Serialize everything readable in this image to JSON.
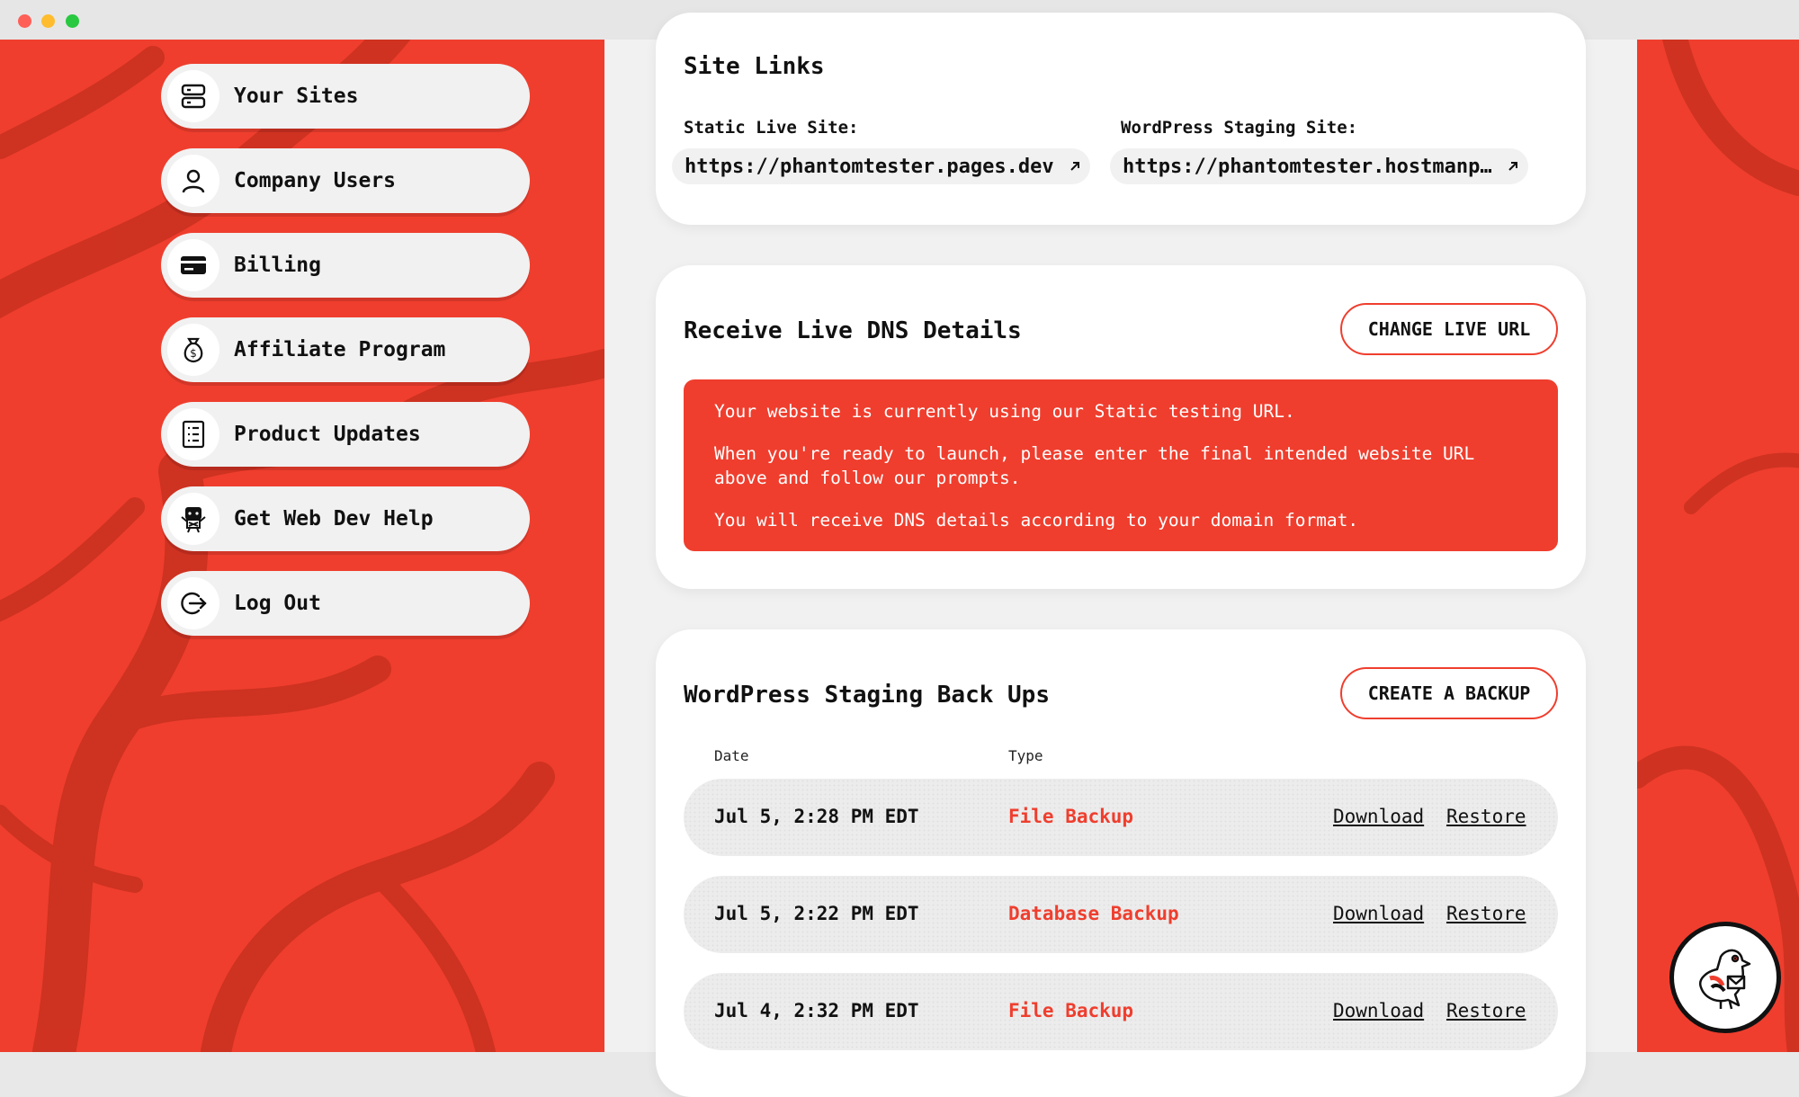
{
  "window": {
    "controls": [
      "close",
      "minimize",
      "maximize"
    ]
  },
  "sidebar": {
    "items": [
      {
        "label": "Your Sites",
        "icon": "server-icon"
      },
      {
        "label": "Company Users",
        "icon": "user-icon"
      },
      {
        "label": "Billing",
        "icon": "credit-card-icon"
      },
      {
        "label": "Affiliate Program",
        "icon": "money-bag-icon"
      },
      {
        "label": "Product Updates",
        "icon": "document-list-icon"
      },
      {
        "label": "Get Web Dev Help",
        "icon": "robot-icon"
      },
      {
        "label": "Log Out",
        "icon": "logout-icon"
      }
    ]
  },
  "site_links": {
    "title": "Site Links",
    "static_label": "Static Live Site:",
    "static_url": "https://phantomtester.pages.dev",
    "staging_label": "WordPress Staging Site:",
    "staging_url": "https://phantomtester.hostmanp…"
  },
  "dns": {
    "title": "Receive Live DNS Details",
    "button": "CHANGE LIVE URL",
    "messages": [
      "Your website is currently using our Static testing URL.",
      "When you're ready to launch, please enter the final intended website URL above and follow our prompts.",
      "You will receive DNS details according to your domain format."
    ]
  },
  "backups": {
    "title": "WordPress Staging Back Ups",
    "button": "CREATE A BACKUP",
    "columns": {
      "date": "Date",
      "type": "Type"
    },
    "rows": [
      {
        "date": "Jul 5, 2:28 PM EDT",
        "type": "File Backup",
        "download": "Download",
        "restore": "Restore"
      },
      {
        "date": "Jul 5, 2:22 PM EDT",
        "type": "Database Backup",
        "download": "Download",
        "restore": "Restore"
      },
      {
        "date": "Jul 4, 2:32 PM EDT",
        "type": "File Backup",
        "download": "Download",
        "restore": "Restore"
      }
    ]
  },
  "colors": {
    "brand_red": "#ef3e2e",
    "panel_grey": "#f1f1f1",
    "text": "#111111"
  },
  "support": {
    "icon": "pigeon-mascot-icon"
  }
}
